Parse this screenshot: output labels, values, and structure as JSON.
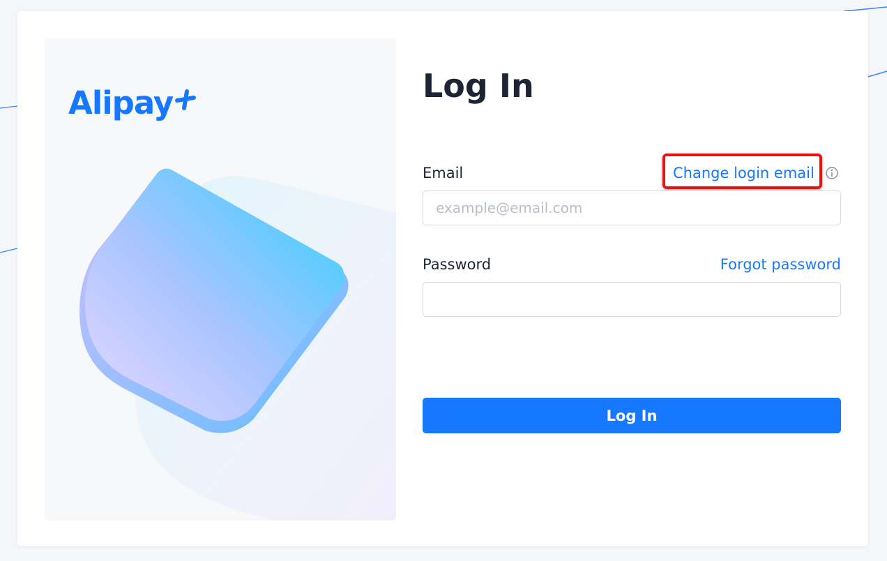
{
  "brand": {
    "logo_text": "Alipay",
    "accent_color": "#1677ff"
  },
  "login": {
    "title": "Log In",
    "email_label": "Email",
    "change_email_link": "Change login email",
    "email_placeholder": "example@email.com",
    "email_value": "",
    "password_label": "Password",
    "forgot_password_link": "Forgot password",
    "password_value": "",
    "submit_label": "Log In"
  },
  "icons": {
    "info": "info-circle-icon",
    "logo_mark": "plus-mark-icon"
  },
  "annotation": {
    "highlight_color": "#ee1111"
  }
}
